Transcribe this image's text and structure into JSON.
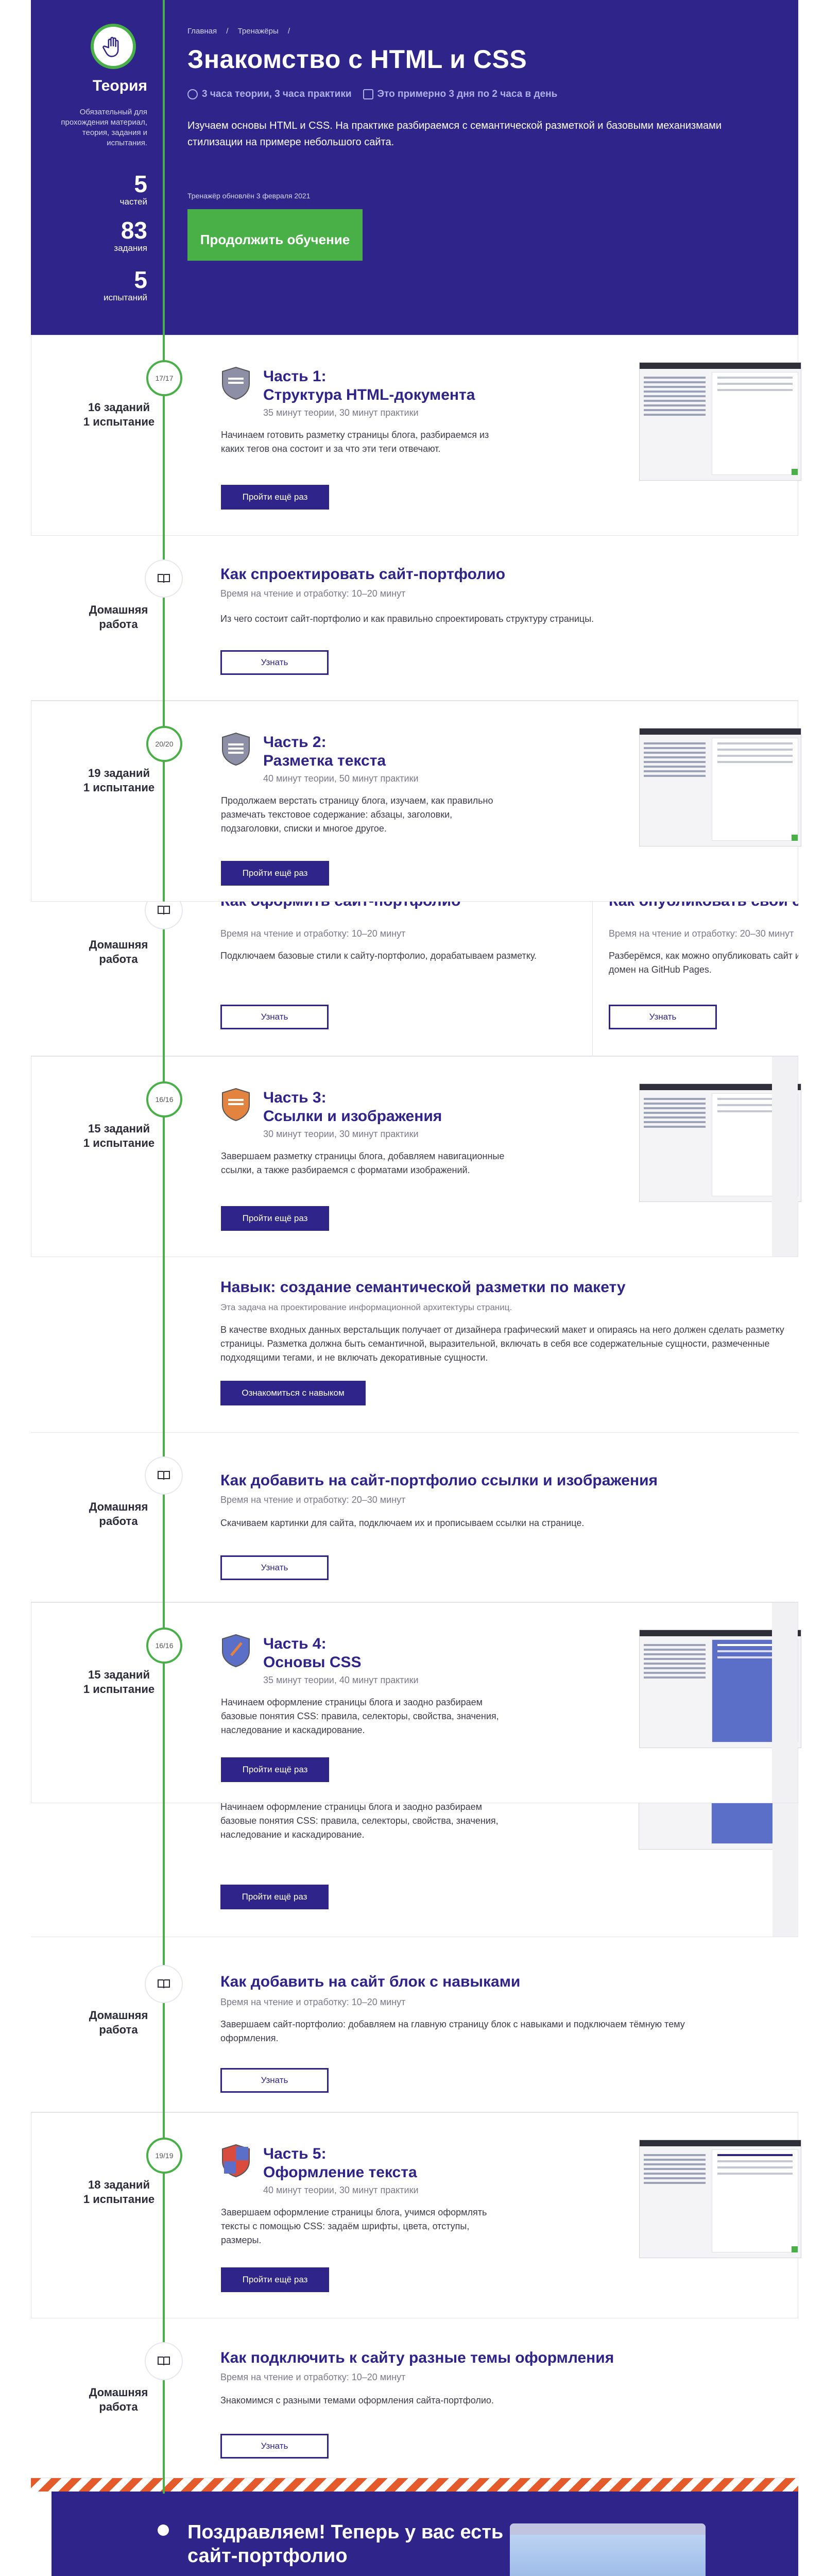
{
  "breadcrumb": [
    "Главная",
    "/",
    "Тренажёры",
    "/"
  ],
  "hero": {
    "title": "Знакомство с HTML и CSS",
    "meta": [
      "3 часа теории, 3 часа практики",
      "Это примерно 3 дня по 2 часа в день"
    ],
    "intro": "Изучаем основы HTML и CSS. На практике разбираемся с семантической разметкой и базовыми механизмами стилизации на примере небольшого сайта.",
    "updated": "Тренажёр обновлён 3 февраля 2021",
    "continue_btn": "Продолжить обучение"
  },
  "sidebar": {
    "theory_label": "Теория",
    "theory_desc": "Обязательный для прохождения материал, теория, задания и испытания.",
    "stats": [
      {
        "value": "5",
        "label": "частей"
      },
      {
        "value": "83",
        "label": "задания"
      },
      {
        "value": "5",
        "label": "испытаний"
      }
    ]
  },
  "parts": [
    {
      "progress": "17/17",
      "side": "16 заданий\n1 испытание",
      "title": "Часть 1:\nСтруктура HTML-документа",
      "sub": "35 минут теории, 30 минут практики",
      "desc": "Начинаем готовить разметку страницы блога, разбираемся из каких тегов она состоит и за что эти теги отвечают.",
      "btn": "Пройти ещё раз"
    },
    {
      "progress": "20/20",
      "side": "19 заданий\n1 испытание",
      "title": "Часть 2:\nРазметка текста",
      "sub": "40 минут теории, 50 минут практики",
      "desc": "Продолжаем верстать страницу блога, изучаем, как правильно размечать текстовое содержание: абзацы, заголовки, подзаголовки, списки и многое другое.",
      "btn": "Пройти ещё раз"
    },
    {
      "progress": "16/16",
      "side": "15 заданий\n1 испытание",
      "title": "Часть 3:\nСсылки и изображения",
      "sub": "30 минут теории, 30 минут практики",
      "desc": "Завершаем разметку страницы блога, добавляем навигационные ссылки, а также разбираемся с форматами изображений.",
      "btn": "Пройти ещё раз"
    },
    {
      "progress": "16/16",
      "side": "15 заданий\n1 испытание",
      "title": "Часть 4:\nОсновы CSS",
      "sub": "35 минут теории, 40 минут практики",
      "desc": "Начинаем оформление страницы блога и заодно разбираем базовые понятия CSS: правила, селекторы, свойства, значения, наследование и каскадирование.",
      "btn": "Пройти ещё раз"
    },
    {
      "progress": "19/19",
      "side": "18 заданий\n1 испытание",
      "title": "Часть 5:\nОформление текста",
      "sub": "40 минут теории, 30 минут практики",
      "desc": "Завершаем оформление страницы блога, учимся оформлять тексты с помощью CSS: задаём шрифты, цвета, отступы, размеры.",
      "btn": "Пройти ещё раз"
    }
  ],
  "homework": [
    {
      "side": "Домашняя\nработа",
      "title": "Как спроектировать сайт-портфолио",
      "sub": "Время на чтение и отработку: 10–20 минут",
      "desc": "Из чего состоит сайт-портфолио и как правильно спроектировать структуру страницы.",
      "btn": "Узнать"
    },
    {
      "side": "Домашняя\nработа",
      "title": "Как оформить сайт-портфолио",
      "sub": "Время на чтение и отработку: 10–20 минут",
      "desc": "Подключаем базовые стили к сайту-портфолио, дорабатываем разметку.",
      "btn": "Узнать"
    },
    {
      "side": "",
      "title": "Как опубликовать свой сайт на",
      "sub": "Время на чтение и отработку: 20–30 минут",
      "desc": "Разберёмся, как можно опубликовать сайт и при домен на GitHub Pages.",
      "btn": "Узнать"
    },
    {
      "side": "Домашняя\nработа",
      "title": "Как добавить на сайт-портфолио ссылки и изображения",
      "sub": "Время на чтение и отработку: 20–30 минут",
      "desc": "Скачиваем картинки для сайта, подключаем их и прописываем ссылки на странице.",
      "btn": "Узнать"
    },
    {
      "side": "Домашняя\nработа",
      "title": "Как добавить на сайт блок с навыками",
      "sub": "Время на чтение и отработку: 10–20 минут",
      "desc": "Завершаем сайт-портфолио: добавляем на главную страницу блок с навыками и подключаем тёмную тему оформления.",
      "btn": "Узнать"
    },
    {
      "side": "Домашняя\nработа",
      "title": "Как подключить к сайту разные темы оформления",
      "sub": "Время на чтение и отработку: 10–20 минут",
      "desc": "Знакомимся с разными темами оформления сайта-портфолио.",
      "btn": "Узнать"
    }
  ],
  "skill": {
    "title": "Навык: создание семантической разметки по макету",
    "sub": "Эта задача на проектирование информационной архитектуры страниц.",
    "desc": "В качестве входных данных верстальщик получает от дизайнера графический макет и опираясь на него должен сделать разметку страницы. Разметка должна быть семантичной, выразительной, включать в себя все содержательные сущности, размеченные подходящими тегами, и не включать декоративные сущности.",
    "btn": "Ознакомиться с навыком"
  },
  "part4_dup_desc": "Начинаем оформление страницы блога и заодно разбираем базовые понятия CSS: правила, селекторы, свойства, значения, наследование и каскадирование.",
  "part4_dup_btn": "Пройти ещё раз",
  "finale": {
    "title": "Поздравляем! Теперь у вас есть\nсайт-портфолио"
  },
  "colors": {
    "accent": "#2e2489",
    "success": "#49b048",
    "stripe": "#e55a2b"
  }
}
